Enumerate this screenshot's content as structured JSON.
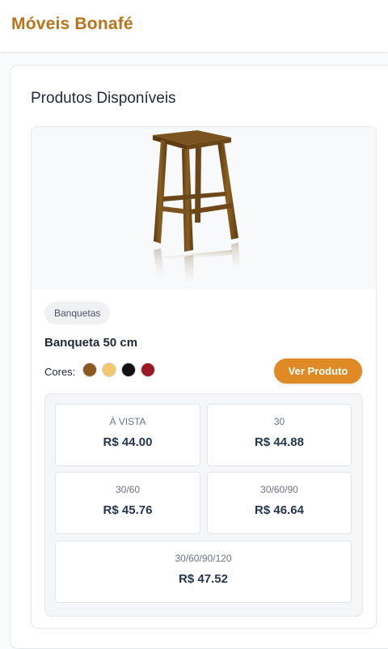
{
  "header": {
    "brand": "Móveis Bonafé"
  },
  "main": {
    "section_title": "Produtos Disponíveis"
  },
  "product": {
    "category": "Banquetas",
    "name": "Banqueta 50 cm",
    "colors_label": "Cores:",
    "colors": [
      "#8a5a1c",
      "#f2c86c",
      "#111111",
      "#9b1822"
    ],
    "view_button": "Ver Produto",
    "image_icon": "wooden-stool-icon",
    "prices": [
      {
        "label": "À VISTA",
        "value": "R$ 44.00"
      },
      {
        "label": "30",
        "value": "R$ 44.88"
      },
      {
        "label": "30/60",
        "value": "R$ 45.76"
      },
      {
        "label": "30/60/90",
        "value": "R$ 46.64"
      },
      {
        "label": "30/60/90/120",
        "value": "R$ 47.52"
      }
    ]
  },
  "theme": {
    "accent": "#e08a26",
    "brand_color": "#b8741a"
  }
}
